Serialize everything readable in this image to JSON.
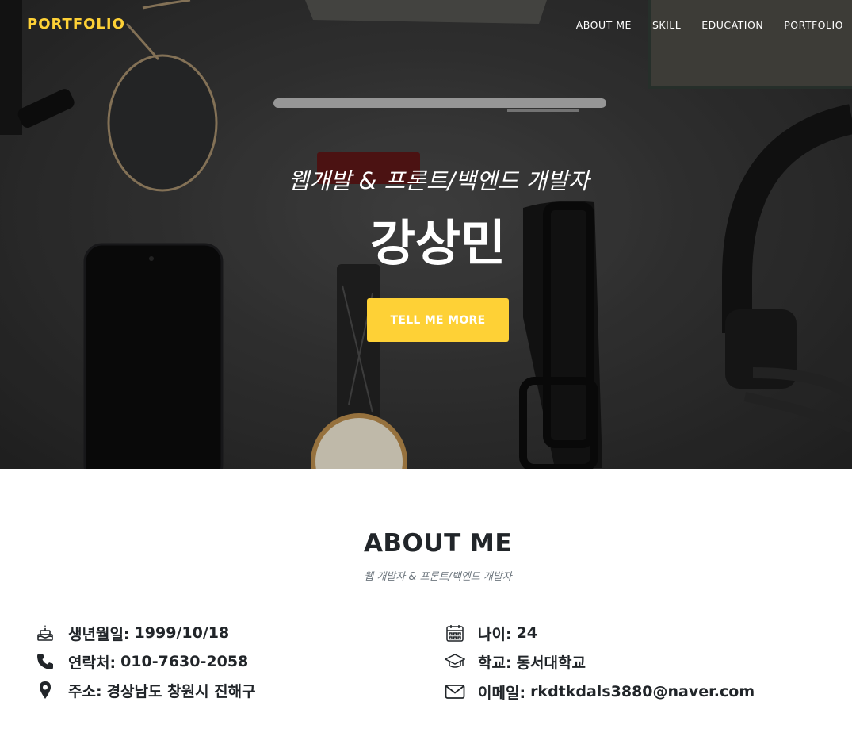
{
  "navbar": {
    "brand": "PORTFOLIO",
    "links": [
      "ABOUT ME",
      "SKILL",
      "EDUCATION",
      "PORTFOLIO"
    ]
  },
  "hero": {
    "subtitle": "웹개발 & 프론트/백엔드 개발자",
    "name": "강상민",
    "cta_label": "TELL ME MORE"
  },
  "about": {
    "title": "ABOUT ME",
    "subtitle": "웹 개발자 & 프론트/백엔드 개발자",
    "left": [
      {
        "icon": "birthday-cake-icon",
        "label": "생년월일",
        "value": "1999/10/18"
      },
      {
        "icon": "phone-icon",
        "label": "연락처",
        "value": "010-7630-2058"
      },
      {
        "icon": "map-marker-icon",
        "label": "주소",
        "value": "경상남도 창원시 진해구"
      }
    ],
    "right": [
      {
        "icon": "calendar-icon",
        "label": "나이",
        "value": "24"
      },
      {
        "icon": "graduation-cap-icon",
        "label": "학교",
        "value": "동서대학교"
      },
      {
        "icon": "envelope-icon",
        "label": "이메일",
        "value": "rkdtkdals3880@naver.com"
      }
    ]
  },
  "colors": {
    "accent": "#fed136",
    "text_dark": "#212529",
    "text_muted": "#6c757d"
  }
}
